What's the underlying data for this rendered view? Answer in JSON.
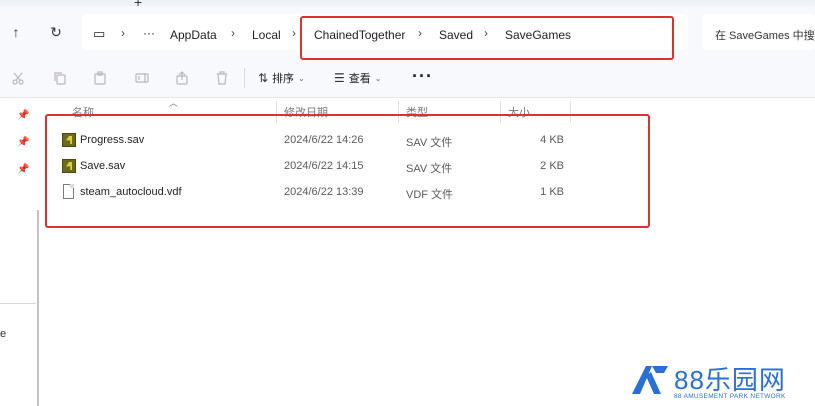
{
  "nav": {
    "new_tab": "+",
    "back_glyph": "↑",
    "refresh_glyph": "↻",
    "pc_glyph": "▭",
    "more_glyph": "···",
    "sep_glyph": "›",
    "crumbs": [
      "AppData",
      "Local",
      "ChainedTogether",
      "Saved",
      "SaveGames"
    ],
    "search_placeholder": "在 SaveGames 中搜"
  },
  "toolbar": {
    "sort_label": "排序",
    "view_label": "查看",
    "more_label": "···",
    "dropdown_glyph": "⌄"
  },
  "columns": {
    "name": "名称",
    "modified": "修改日期",
    "type": "类型",
    "size": "大小"
  },
  "files": [
    {
      "name": "Progress.sav",
      "modified": "2024/6/22 14:26",
      "type": "SAV 文件",
      "size": "4 KB",
      "icon": "sav-file-icon"
    },
    {
      "name": "Save.sav",
      "modified": "2024/6/22 14:15",
      "type": "SAV 文件",
      "size": "2 KB",
      "icon": "sav-file-icon"
    },
    {
      "name": "steam_autocloud.vdf",
      "modified": "2024/6/22 13:39",
      "type": "VDF 文件",
      "size": "1 KB",
      "icon": "document-icon"
    }
  ],
  "sidebar": {
    "pin_glyph": "📌",
    "partial_letter": "e"
  },
  "watermark": {
    "brand": "88乐园网",
    "tagline": "88 AMUSEMENT PARK NETWORK",
    "color": "#2a6fd6"
  },
  "highlight_color": "#d63434"
}
